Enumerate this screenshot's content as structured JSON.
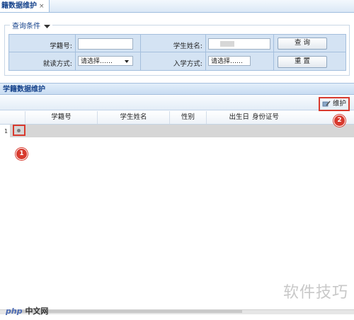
{
  "tab": {
    "label": "籍数据维护",
    "close": "×"
  },
  "query": {
    "legend": "查询条件",
    "student_no_label": "学籍号:",
    "student_name_label": "学生姓名:",
    "study_mode_label": "就读方式:",
    "study_mode_value": "请选择……",
    "enroll_mode_label": "入学方式:",
    "enroll_mode_value": "请选择……",
    "search_button": "查 询",
    "reset_button": "重 置"
  },
  "panel": {
    "title": "学籍数据维护",
    "maintain_button": "维护"
  },
  "grid": {
    "columns": [
      "学籍号",
      "学生姓名",
      "性别",
      "出生日",
      "身份证号"
    ],
    "rows": [
      {
        "num": "1"
      }
    ]
  },
  "annotations": {
    "badge1": "1",
    "badge2": "2"
  },
  "watermark": {
    "right": "软件技巧",
    "left_brand": "php",
    "left_text": "中文网"
  }
}
